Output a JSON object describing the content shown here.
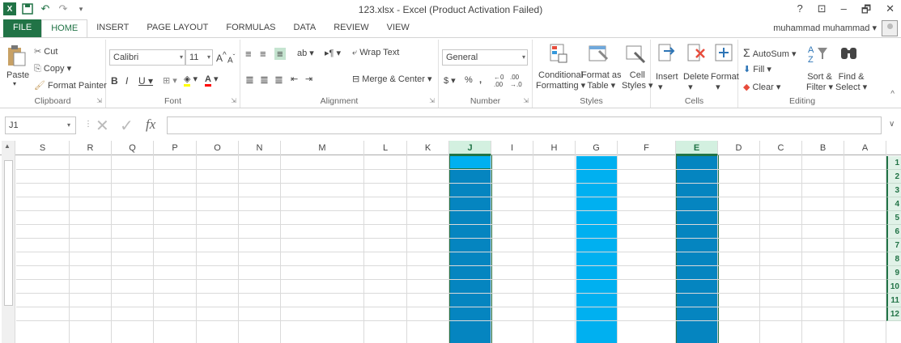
{
  "title": "123.xlsx - Excel (Product Activation Failed)",
  "user": "muhammad muhammad",
  "tabs": [
    "FILE",
    "HOME",
    "INSERT",
    "PAGE LAYOUT",
    "FORMULAS",
    "DATA",
    "REVIEW",
    "VIEW"
  ],
  "active_tab": "HOME",
  "window_controls": [
    "?",
    "⊡",
    "–",
    "🗗",
    "✕"
  ],
  "ribbon": {
    "clipboard": {
      "label": "Clipboard",
      "paste": "Paste",
      "cut": "Cut",
      "copy": "Copy",
      "format_painter": "Format Painter"
    },
    "font": {
      "label": "Font",
      "name": "Calibri",
      "size": "11"
    },
    "alignment": {
      "label": "Alignment",
      "wrap": "Wrap Text",
      "merge": "Merge & Center"
    },
    "number": {
      "label": "Number",
      "format": "General",
      "currency": "$",
      "percent": "%",
      "comma": ","
    },
    "styles": {
      "label": "Styles",
      "conditional": "Conditional",
      "conditional2": "Formatting",
      "format_table": "Format as",
      "format_table2": "Table",
      "cell": "Cell",
      "cell2": "Styles"
    },
    "cells": {
      "label": "Cells",
      "insert": "Insert",
      "delete": "Delete",
      "format": "Format"
    },
    "editing": {
      "label": "Editing",
      "autosum": "AutoSum",
      "fill": "Fill",
      "clear": "Clear",
      "sort": "Sort &",
      "sort2": "Filter",
      "find": "Find &",
      "find2": "Select"
    }
  },
  "name_box": "J1",
  "columns": [
    "S",
    "R",
    "Q",
    "P",
    "O",
    "N",
    "M",
    "L",
    "K",
    "J",
    "I",
    "H",
    "G",
    "F",
    "E",
    "D",
    "C",
    "B",
    "A"
  ],
  "selected_columns": [
    "J",
    "E"
  ],
  "rows": [
    "1",
    "2",
    "3",
    "4",
    "5",
    "6",
    "7",
    "8",
    "9",
    "10",
    "11",
    "12"
  ],
  "colors": {
    "accent": "#217346",
    "dark_fill": "#0585c0",
    "light_fill": "#00b0f0"
  }
}
